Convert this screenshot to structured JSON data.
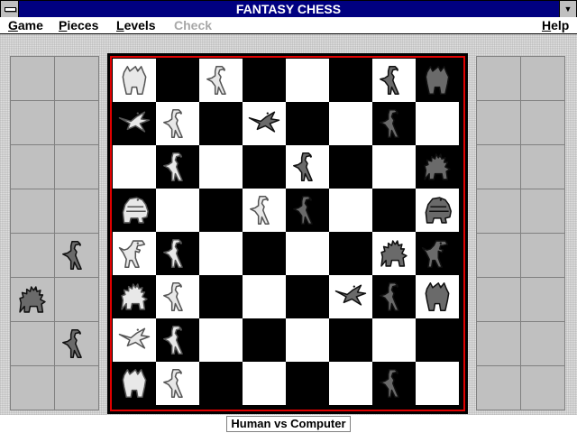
{
  "window": {
    "title": "FANTASY CHESS"
  },
  "menu": [
    {
      "label": "Game",
      "u": "G",
      "rest": "ame",
      "enabled": true
    },
    {
      "label": "Pieces",
      "u": "P",
      "rest": "ieces",
      "enabled": true
    },
    {
      "label": "Levels",
      "u": "L",
      "rest": "evels",
      "enabled": true
    },
    {
      "label": "Check",
      "u": "",
      "rest": "Check",
      "enabled": false
    },
    {
      "label": "Help",
      "u": "H",
      "rest": "elp",
      "enabled": true
    }
  ],
  "status": "Human vs Computer",
  "colors": {
    "titlebar": "#000080",
    "board_border": "#e00000",
    "light_piece": "#e8e8e8",
    "dark_piece": "#6a6a6a"
  },
  "piece_icons": {
    "trex": "tyrannosaurus-icon",
    "dilo": "dilophosaurus-icon",
    "ptero": "pterodactyl-icon",
    "stego": "stegosaurus-icon",
    "ankylo": "ankylosaurus-icon",
    "tri": "triceratops-icon"
  },
  "board": [
    [
      "tri:w",
      "",
      "dilo:w",
      "",
      "",
      "",
      "dilo:b",
      "tri:b"
    ],
    [
      "ptero:w",
      "dilo:w",
      "",
      "ptero:b",
      "",
      "",
      "dilo:b",
      ""
    ],
    [
      "",
      "dilo:w",
      "",
      "",
      "dilo:b",
      "",
      "",
      "stego:b"
    ],
    [
      "ankylo:w",
      "",
      "",
      "dilo:w",
      "dilo:b",
      "",
      "",
      "ankylo:b"
    ],
    [
      "trex:w",
      "dilo:w",
      "",
      "",
      "",
      "",
      "stego:b",
      "trex:b"
    ],
    [
      "stego:w",
      "dilo:w",
      "",
      "",
      "",
      "ptero:b",
      "dilo:b",
      "tri:b"
    ],
    [
      "ptero:w",
      "dilo:w",
      "",
      "",
      "",
      "",
      "",
      ""
    ],
    [
      "tri:w",
      "dilo:w",
      "",
      "",
      "",
      "",
      "dilo:b",
      ""
    ]
  ],
  "captured_left": [
    [
      "",
      ""
    ],
    [
      "",
      ""
    ],
    [
      "",
      ""
    ],
    [
      "",
      ""
    ],
    [
      "",
      "dilo:b"
    ],
    [
      "stego:b",
      ""
    ],
    [
      "",
      "dilo:b"
    ],
    [
      "",
      ""
    ]
  ],
  "captured_right": [
    [
      "",
      ""
    ],
    [
      "",
      ""
    ],
    [
      "",
      ""
    ],
    [
      "",
      ""
    ],
    [
      "",
      ""
    ],
    [
      "",
      ""
    ],
    [
      "",
      ""
    ],
    [
      "",
      ""
    ]
  ]
}
